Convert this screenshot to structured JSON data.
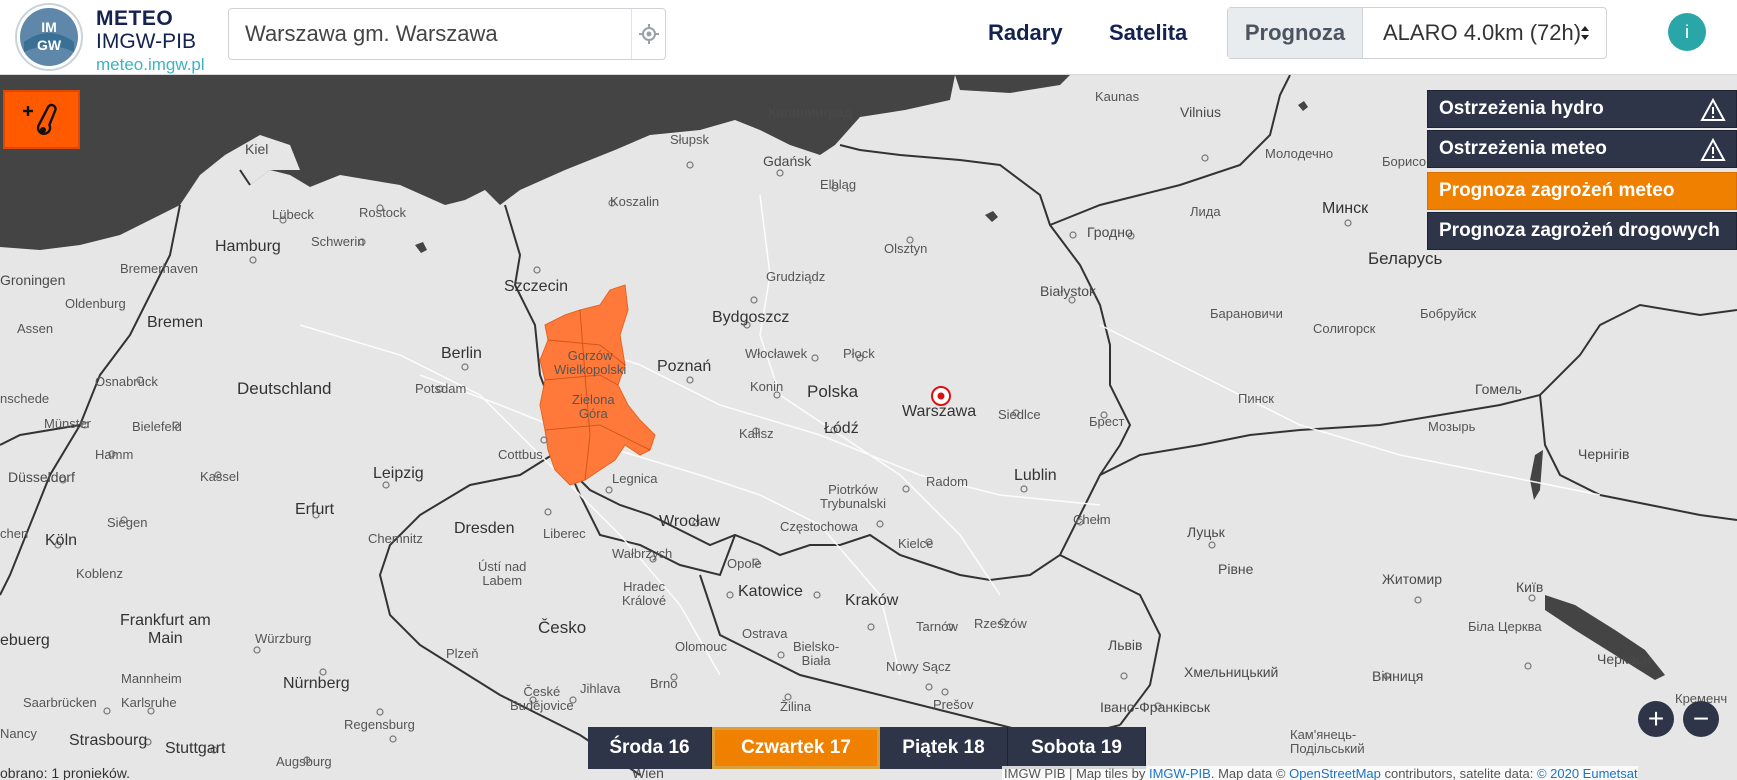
{
  "header": {
    "brand_line1": "METEO",
    "brand_line2": "IMGW-PIB",
    "brand_line3": "meteo.imgw.pl",
    "logo_text": "IMGW",
    "search_value": "Warszawa gm. Warszawa",
    "nav_radars": "Radary",
    "nav_satellite": "Satelita",
    "forecast_label": "Prognoza",
    "forecast_model": "ALARO 4.0km (72h)",
    "info_icon": "i"
  },
  "warnings": {
    "hydro": "Ostrzeżenia hydro",
    "meteo": "Ostrzeżenia meteo",
    "threat_meteo": "Prognoza zagrożeń meteo",
    "threat_road": "Prognoza zagrożeń drogowych"
  },
  "days": [
    {
      "label": "Środa 16",
      "active": false
    },
    {
      "label": "Czwartek 17",
      "active": true
    },
    {
      "label": "Piątek 18",
      "active": false
    },
    {
      "label": "Sobota 19",
      "active": false
    }
  ],
  "zoom": {
    "plus": "+",
    "minus": "−"
  },
  "status_text": "obrano: 1 pronieków.",
  "attribution": {
    "prefix": "IMGW PIB | Map tiles by ",
    "link1": "IMGW-PIB",
    "mid1": ". Map data © ",
    "link2": "OpenStreetMap",
    "mid2": " contributors, satelite data: ",
    "link3": "© 2020 Eumetsat"
  },
  "map_labels": {
    "kaliningrad": "Калининград",
    "kaunas": "Kaunas",
    "vilnius": "Vilnius",
    "molodechno": "Молодечно",
    "borisov": "Борисо",
    "kiel": "Kiel",
    "slupsk": "Słupsk",
    "gdansk": "Gdańsk",
    "elblag": "Elbląg",
    "lubeck": "Lübeck",
    "rostock": "Rostock",
    "koszalin": "Koszalin",
    "lida": "Лида",
    "minsk": "Минск",
    "hamburg": "Hamburg",
    "schwerin": "Schwerin",
    "olsztyn": "Olsztyn",
    "grodno": "Гродно",
    "bremerhaven": "Bremerhaven",
    "belarus": "Беларусь",
    "groningen": "Groningen",
    "oldenburg": "Oldenburg",
    "bremen": "Bremen",
    "szczecin": "Szczecin",
    "grudziadz": "Grudziądz",
    "bialystok": "Białystok",
    "baranovichi": "Барановичи",
    "soligorsk": "Солигорск",
    "bobruisk": "Бобруйск",
    "assen": "Assen",
    "bydgoszcz": "Bydgoszcz",
    "berlin": "Berlin",
    "gorzow": "Gorzów\nWielkopolski",
    "wloclawek": "Włocławek",
    "plock": "Płock",
    "poznan": "Poznań",
    "osnabruck": "Osnabrück",
    "deutschland": "Deutschland",
    "potsdam": "Potsdam",
    "konin": "Konin",
    "polska": "Polska",
    "pinsk": "Пинск",
    "gomel": "Гомель",
    "enschede": "nschede",
    "zielona": "Zielona\nGóra",
    "warszawa": "Warszawa",
    "siedlce": "Siedlce",
    "brest": "Брест",
    "munster": "Münster",
    "bielefeld": "Bielefeld",
    "kalisz": "Kalisz",
    "lodz": "Łódź",
    "mozyr": "Мозырь",
    "hamm": "Hamm",
    "cottbus": "Cottbus",
    "chernihiv": "Чернігів",
    "dusseldorf": "Düsseldorf",
    "kassel": "Kassel",
    "leipzig": "Leipzig",
    "legnica": "Legnica",
    "piotrkow": "Piotrków\nTrybunalski",
    "radom": "Radom",
    "lublin": "Lublin",
    "erfurt": "Erfurt",
    "siegen": "Siegen",
    "wroclaw": "Wrocław",
    "chelm": "Chełm",
    "czestochowa": "Częstochowa",
    "chemnitz": "Chemnitz",
    "dresden": "Dresden",
    "liberec": "Liberec",
    "koln": "Köln",
    "walbrzych": "Wałbrzych",
    "lutsk": "Луцьк",
    "kielce": "Kielce",
    "chen": "chen",
    "koblenz": "Koblenz",
    "usti": "Ústí nad\nLabem",
    "opole": "Opole",
    "rivne": "Рівне",
    "zhytomyr": "Житомир",
    "hradec": "Hradec\nKrálové",
    "katowice": "Katowice",
    "krakow": "Kraków",
    "kyiv": "Київ",
    "frankfurt": "Frankfurt am\nMain",
    "cesko": "Česko",
    "tarnow": "Tarnów",
    "rzeszow": "Rzeszów",
    "bila": "Біла Церква",
    "wurzburg": "Würzburg",
    "ostrava": "Ostrava",
    "lviv": "Львів",
    "ebuerg": "ebuerg",
    "plzen": "Plzeň",
    "olomouc": "Olomouc",
    "bielsko": "Bielsko-\nBiała",
    "cherkasy": "Черкаси",
    "nowysacz": "Nowy Sącz",
    "khmelnytskyi": "Хмельницький",
    "vinnytsia": "Вінниця",
    "mannheim": "Mannheim",
    "nurnberg": "Nürnberg",
    "brno": "Brno",
    "ceske": "České\nBudějovice",
    "jihlava": "Jihlava",
    "saarbrucken": "Saarbrücken",
    "karlsruhe": "Karlsruhe",
    "zilina": "Žilina",
    "presov": "Prešov",
    "ivano": "Івано-Франківськ",
    "kremen": "Кременч",
    "regensburg": "Regensburg",
    "nancy": "Nancy",
    "strasbourg": "Strasbourg",
    "stuttgart": "Stuttgart",
    "kamianets": "Кам'янець-\nПодільський",
    "augsburg": "Augsburg",
    "wien": "Wien"
  }
}
